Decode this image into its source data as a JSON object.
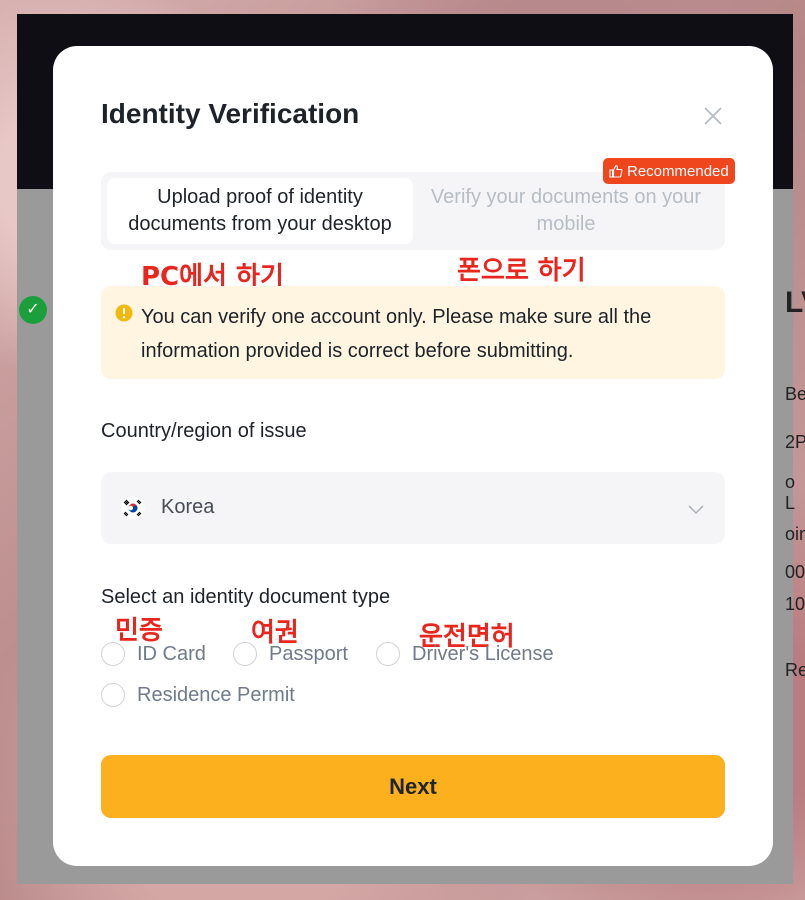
{
  "modal": {
    "title": "Identity Verification",
    "close_icon": "close-icon"
  },
  "tabs": {
    "desktop_label": "Upload proof of identity documents from your desktop",
    "mobile_label": "Verify your documents on your mobile",
    "recommended_badge": "Recommended",
    "badge_icon": "thumbs-up-icon"
  },
  "annotations": {
    "pc": "PC에서 하기",
    "phone": "폰으로 하기",
    "id_card": "민증",
    "passport": "여권",
    "license": "운전면허"
  },
  "warning": {
    "icon": "warning-icon",
    "text": "You can verify one account only. Please make sure all the information provided is correct before submitting."
  },
  "country": {
    "label": "Country/region of issue",
    "value": "Korea",
    "flag_icon": "korea-flag-icon",
    "chevron_icon": "chevron-down-icon"
  },
  "document_type": {
    "label": "Select an identity document type",
    "options": [
      "ID Card",
      "Passport",
      "Driver's License",
      "Residence Permit"
    ]
  },
  "next_button": "Next",
  "background": {
    "side_text": [
      "LV",
      "Ben",
      "2P",
      "o L",
      "oin",
      "00",
      "10",
      "Rec"
    ]
  },
  "colors": {
    "accent": "#fcb01e",
    "badge": "#f0461e",
    "warning_bg": "#fff5e0",
    "annotation": "#e8261e"
  }
}
